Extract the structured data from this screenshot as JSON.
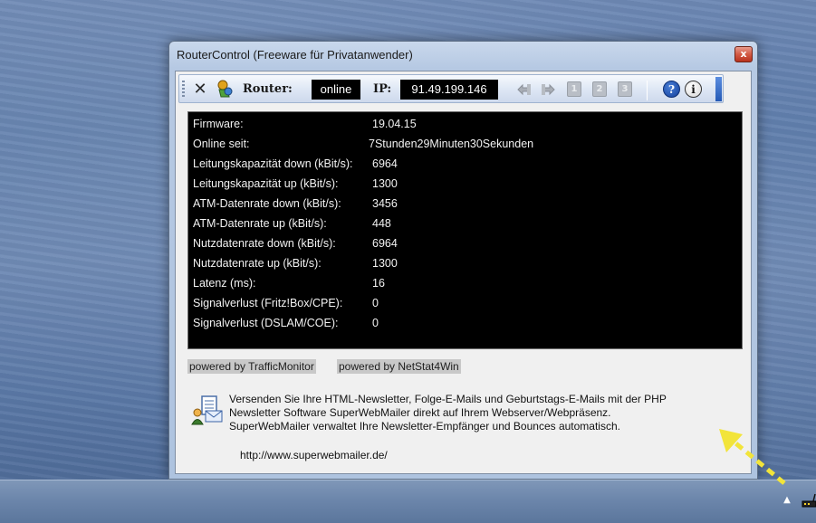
{
  "window": {
    "title": "RouterControl (Freeware für Privatanwender)",
    "close_glyph": "x"
  },
  "toolbar": {
    "disconnect_glyph": "✕",
    "router_label": "Router:",
    "router_status": "online",
    "ip_label": "IP:",
    "ip_value": "91.49.199.146",
    "preset_buttons": [
      "1",
      "2",
      "3"
    ],
    "help_glyph": "?",
    "info_glyph": "i",
    "icons": [
      "disconnect-icon",
      "connect-icon",
      "reconnect-icon",
      "refresh-icon",
      "help-icon",
      "info-icon"
    ]
  },
  "info": {
    "rows": [
      {
        "label": "Firmware:",
        "value": "19.04.15"
      },
      {
        "label": "Online seit:",
        "value": "7Stunden29Minuten30Sekunden"
      },
      {
        "label": "Leitungskapazität down (kBit/s):",
        "value": "6964"
      },
      {
        "label": "Leitungskapazität up (kBit/s):",
        "value": "1300"
      },
      {
        "label": "ATM-Datenrate down (kBit/s):",
        "value": "3456"
      },
      {
        "label": "ATM-Datenrate up (kBit/s):",
        "value": "448"
      },
      {
        "label": "Nutzdatenrate down (kBit/s):",
        "value": "6964"
      },
      {
        "label": "Nutzdatenrate up (kBit/s):",
        "value": "1300"
      },
      {
        "label": "Latenz (ms):",
        "value": "16"
      },
      {
        "label": "Signalverlust (Fritz!Box/CPE):",
        "value": "0"
      },
      {
        "label": "Signalverlust (DSLAM/COE):",
        "value": "0"
      }
    ]
  },
  "powered": {
    "traffic_monitor": "powered by TrafficMonitor",
    "netstat": "powered by NetStat4Win"
  },
  "ad": {
    "line1": "Versenden Sie Ihre HTML-Newsletter, Folge-E-Mails und Geburtstags-E-Mails mit der PHP",
    "line2": "Newsletter Software SuperWebMailer direkt auf Ihrem Webserver/Webpräsenz.",
    "line3": "SuperWebMailer verwaltet Ihre Newsletter-Empfänger und Bounces automatisch.",
    "link": "http://www.superwebmailer.de/"
  },
  "taskbar": {
    "tray_chevron": "▲"
  },
  "colors": {
    "annotation_arrow": "#f2e43a",
    "info_background": "#000000",
    "info_text": "#f2f2f2",
    "close_button": "#d35a44"
  }
}
